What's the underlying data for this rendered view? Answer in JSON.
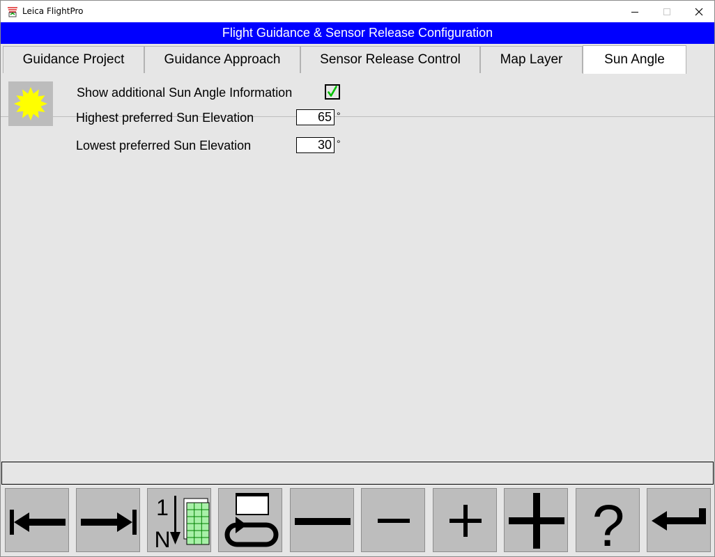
{
  "window": {
    "title": "Leica FlightPro"
  },
  "header": {
    "title": "Flight Guidance & Sensor Release Configuration"
  },
  "tabs": [
    {
      "label": "Guidance Project",
      "active": false
    },
    {
      "label": "Guidance Approach",
      "active": false
    },
    {
      "label": "Sensor Release Control",
      "active": false
    },
    {
      "label": "Map Layer",
      "active": false
    },
    {
      "label": "Sun Angle",
      "active": true
    }
  ],
  "sun_angle": {
    "show_info_label": "Show additional Sun Angle Information",
    "show_info_checked": true,
    "highest_label": "Highest preferred Sun Elevation",
    "highest_value": "65",
    "lowest_label": "Lowest preferred Sun Elevation",
    "lowest_value": "30",
    "unit": "°"
  },
  "status_bar": {
    "text": ""
  },
  "toolbar": {
    "buttons": [
      {
        "icon": "arrow-left-bar-icon"
      },
      {
        "icon": "arrow-right-bar-icon"
      },
      {
        "icon": "sort-1-to-n-icon",
        "text_top": "1",
        "text_bottom": "N"
      },
      {
        "icon": "window-cycle-icon"
      },
      {
        "icon": "large-minus-icon"
      },
      {
        "icon": "small-minus-icon"
      },
      {
        "icon": "small-plus-icon"
      },
      {
        "icon": "large-plus-icon"
      },
      {
        "icon": "help-icon",
        "text": "?"
      },
      {
        "icon": "enter-icon"
      }
    ]
  },
  "colors": {
    "header_blue": "#0000ff",
    "sun_yellow": "#ffff00",
    "check_green": "#00c000",
    "grid_green": "#a8f0a8"
  }
}
